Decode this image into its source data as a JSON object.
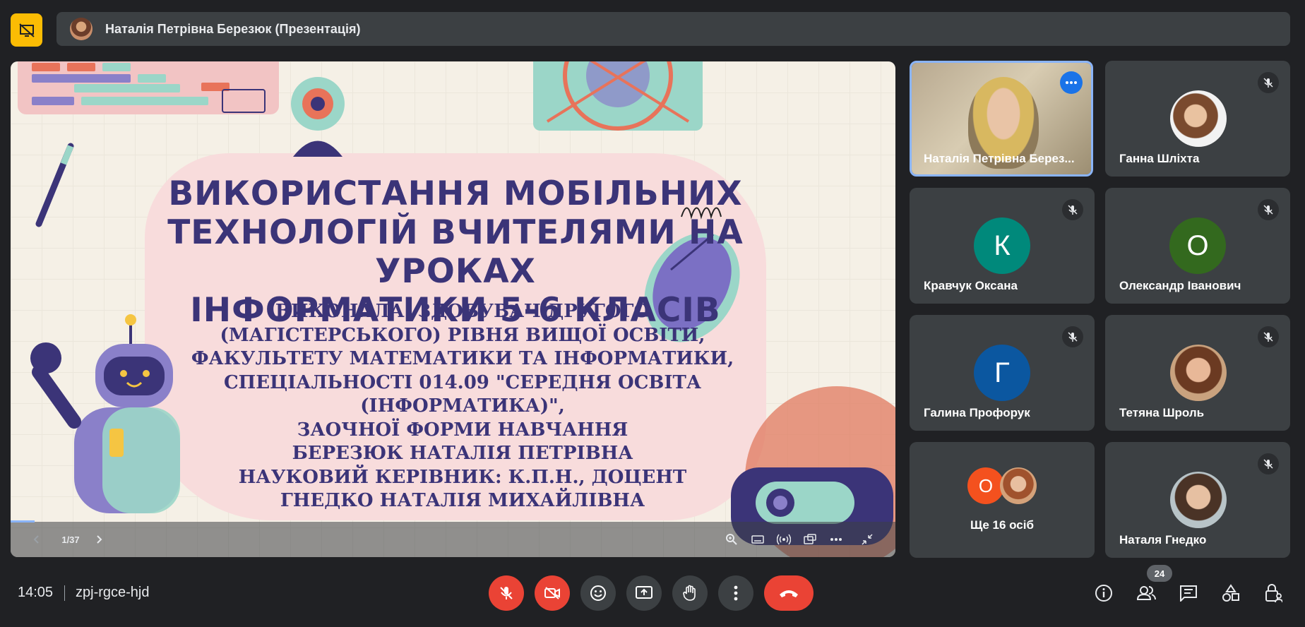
{
  "header": {
    "title": "Наталія Петрівна Березюк (Презентація)"
  },
  "slide": {
    "title_lines": [
      "ВИКОРИСТАННЯ МОБІЛЬНИХ",
      "ТЕХНОЛОГІЙ ВЧИТЕЛЯМИ НА УРОКАХ",
      "ІНФОРМАТИКИ 5-6 КЛАСІВ"
    ],
    "subtitle_lines": [
      "ВИКОНАЛА: ЗДОБУВАЧ ДРУГОГО",
      "(МАГІСТЕРСЬКОГО) РІВНЯ ВИЩОЇ ОСВІТИ,",
      "ФАКУЛЬТЕТУ МАТЕМАТИКИ ТА ІНФОРМАТИКИ,",
      "СПЕЦІАЛЬНОСТІ 014.09 \"СЕРЕДНЯ ОСВІТА",
      "(ІНФОРМАТИКА)\",",
      "ЗАОЧНОЇ ФОРМИ НАВЧАННЯ",
      "БЕРЕЗЮК НАТАЛІЯ ПЕТРІВНА",
      "НАУКОВИЙ КЕРІВНИК: К.П.Н., ДОЦЕНТ",
      "ГНЕДКО НАТАЛІЯ МИХАЙЛІВНА"
    ],
    "page_indicator": "1/37"
  },
  "participants": [
    {
      "name": "Наталія Петрівна Берез...",
      "type": "video"
    },
    {
      "name": "Ганна Шліхта",
      "type": "photo"
    },
    {
      "name": "Кравчук Оксана",
      "initial": "К",
      "color": "#00897b"
    },
    {
      "name": "Олександр Іванович",
      "initial": "О",
      "color": "#33691e"
    },
    {
      "name": "Галина Профорук",
      "initial": "Г",
      "color": "#0b57a0"
    },
    {
      "name": "Тетяна Шроль",
      "type": "photo"
    },
    {
      "name": "Ще 16 осіб",
      "initial": "О",
      "color": "#f4511e"
    },
    {
      "name": "Наталя Гнедко",
      "type": "photo"
    }
  ],
  "footer": {
    "time": "14:05",
    "meeting_code": "zpj-rgce-hjd",
    "participant_count": "24"
  },
  "colors": {
    "accent": "#8ab4f8",
    "danger": "#ea4335",
    "badge": "#fbbc04"
  }
}
